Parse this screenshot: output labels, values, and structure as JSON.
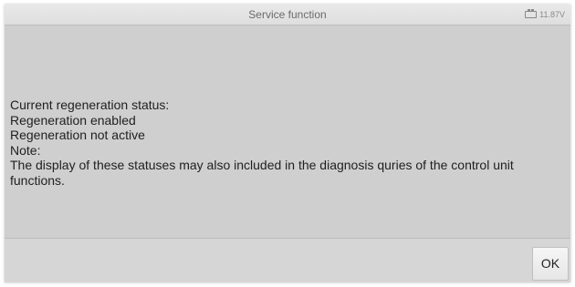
{
  "window": {
    "title": "Service function",
    "battery_voltage": "11.87V"
  },
  "message": {
    "lines": [
      "Current regeneration status:",
      "Regeneration enabled",
      "Regeneration not active",
      "Note:",
      "The display of these statuses may also included in the diagnosis quries of the control unit functions."
    ]
  },
  "footer": {
    "ok_label": "OK"
  }
}
